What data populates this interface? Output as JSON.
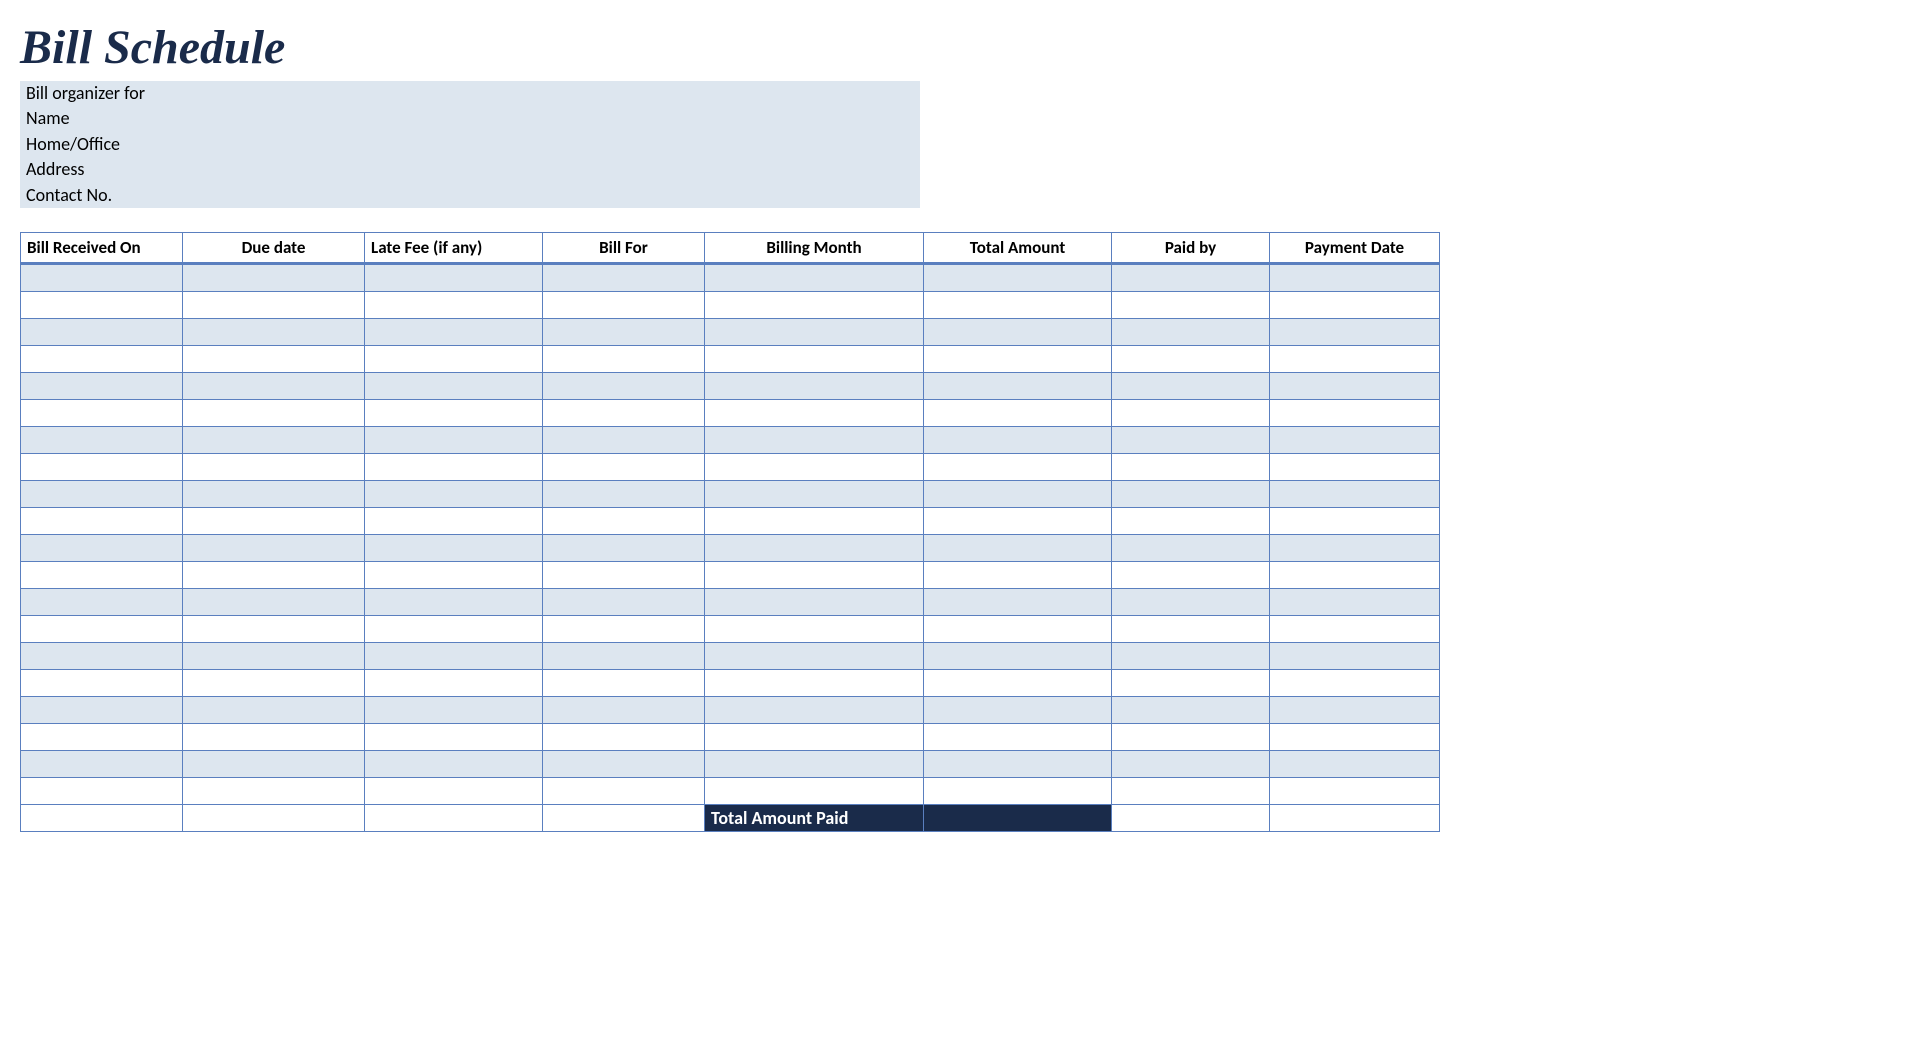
{
  "title": "Bill Schedule",
  "info": {
    "label_organizer": "Bill organizer for",
    "label_name": "Name",
    "label_home_office": "Home/Office",
    "label_address": "Address",
    "label_contact": "Contact No."
  },
  "table": {
    "headers": [
      "Bill Received On",
      "Due date",
      "Late Fee (if any)",
      "Bill For",
      "Billing Month",
      "Total Amount",
      "Paid by",
      "Payment Date"
    ],
    "row_count": 20,
    "footer_label": "Total  Amount Paid",
    "footer_value": ""
  }
}
